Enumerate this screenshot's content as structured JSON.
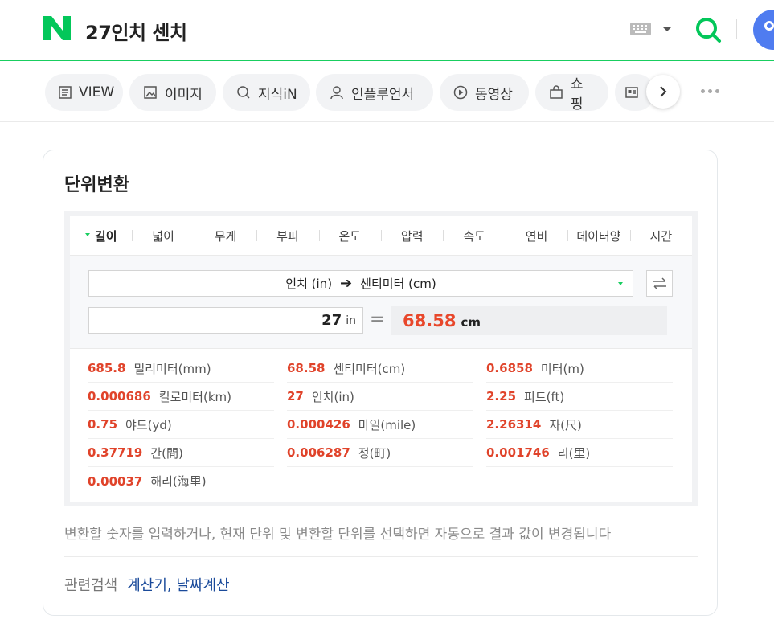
{
  "header": {
    "query": "27인치 센치"
  },
  "tabs": [
    {
      "label": "VIEW",
      "icon": "view-icon"
    },
    {
      "label": "이미지",
      "icon": "image-icon"
    },
    {
      "label": "지식iN",
      "icon": "search-icon"
    },
    {
      "label": "인플루언서",
      "icon": "person-icon"
    },
    {
      "label": "동영상",
      "icon": "play-icon"
    },
    {
      "label": "쇼핑",
      "icon": "bag-icon"
    }
  ],
  "card": {
    "title": "단위변환",
    "categories": [
      "길이",
      "넓이",
      "무게",
      "부피",
      "온도",
      "압력",
      "속도",
      "연비",
      "데이터양",
      "시간"
    ],
    "active_category": "길이",
    "from_unit": "인치 (in)",
    "to_unit": "센티미터 (cm)",
    "input_value": "27",
    "input_unit": "in",
    "equals": "=",
    "result_value": "68.58",
    "result_unit": "cm",
    "conversions": [
      {
        "num": "685.8",
        "label": "밀리미터(mm)"
      },
      {
        "num": "68.58",
        "label": "센티미터(cm)"
      },
      {
        "num": "0.6858",
        "label": "미터(m)"
      },
      {
        "num": "0.000686",
        "label": "킬로미터(km)"
      },
      {
        "num": "27",
        "label": "인치(in)"
      },
      {
        "num": "2.25",
        "label": "피트(ft)"
      },
      {
        "num": "0.75",
        "label": "야드(yd)"
      },
      {
        "num": "0.000426",
        "label": "마일(mile)"
      },
      {
        "num": "2.26314",
        "label": "자(尺)"
      },
      {
        "num": "0.37719",
        "label": "간(間)"
      },
      {
        "num": "0.006287",
        "label": "정(町)"
      },
      {
        "num": "0.001746",
        "label": "리(里)"
      },
      {
        "num": "0.00037",
        "label": "해리(海里)"
      }
    ],
    "hint": "변환할 숫자를 입력하거나, 현재 단위 및 변환할 단위를 선택하면 자동으로 결과 값이 변경됩니다",
    "related_label": "관련검색",
    "related_links": "계산기, 날짜계산"
  },
  "colors": {
    "brand": "#19ce60",
    "result": "#e8472b",
    "link": "#1a4a9a"
  }
}
